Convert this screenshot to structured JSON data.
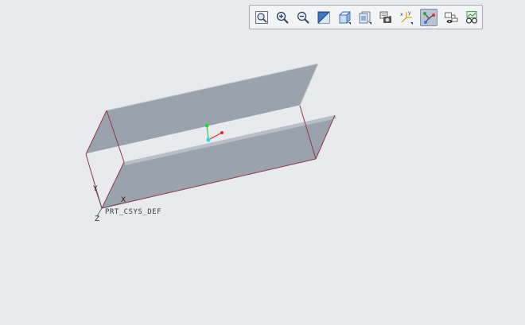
{
  "colors": {
    "background": "#e9eaee",
    "surface": "#9aa2ae",
    "edge": "#8a3a48",
    "axis_green": "#2fd04b",
    "axis_cyan": "#35d7e0",
    "axis_red": "#e02a2a"
  },
  "toolbar": {
    "buttons": [
      {
        "name": "refit-icon",
        "active": false
      },
      {
        "name": "zoom-in-icon",
        "active": false
      },
      {
        "name": "zoom-out-icon",
        "active": false
      },
      {
        "name": "repaint-icon",
        "active": false
      },
      {
        "name": "display-style-icon",
        "active": false
      },
      {
        "name": "saved-views-icon",
        "active": false
      },
      {
        "name": "view-manager-icon",
        "active": false
      },
      {
        "name": "datum-display-icon",
        "active": false
      },
      {
        "name": "annotation-display-icon",
        "active": true
      },
      {
        "name": "spin-center-icon",
        "active": false
      },
      {
        "name": "appearance-icon",
        "active": false
      }
    ]
  },
  "model": {
    "csys_label": "PRT_CSYS_DEF",
    "axis_x_label": "X",
    "axis_y_label": "Y",
    "axis_z_label": "Z"
  }
}
